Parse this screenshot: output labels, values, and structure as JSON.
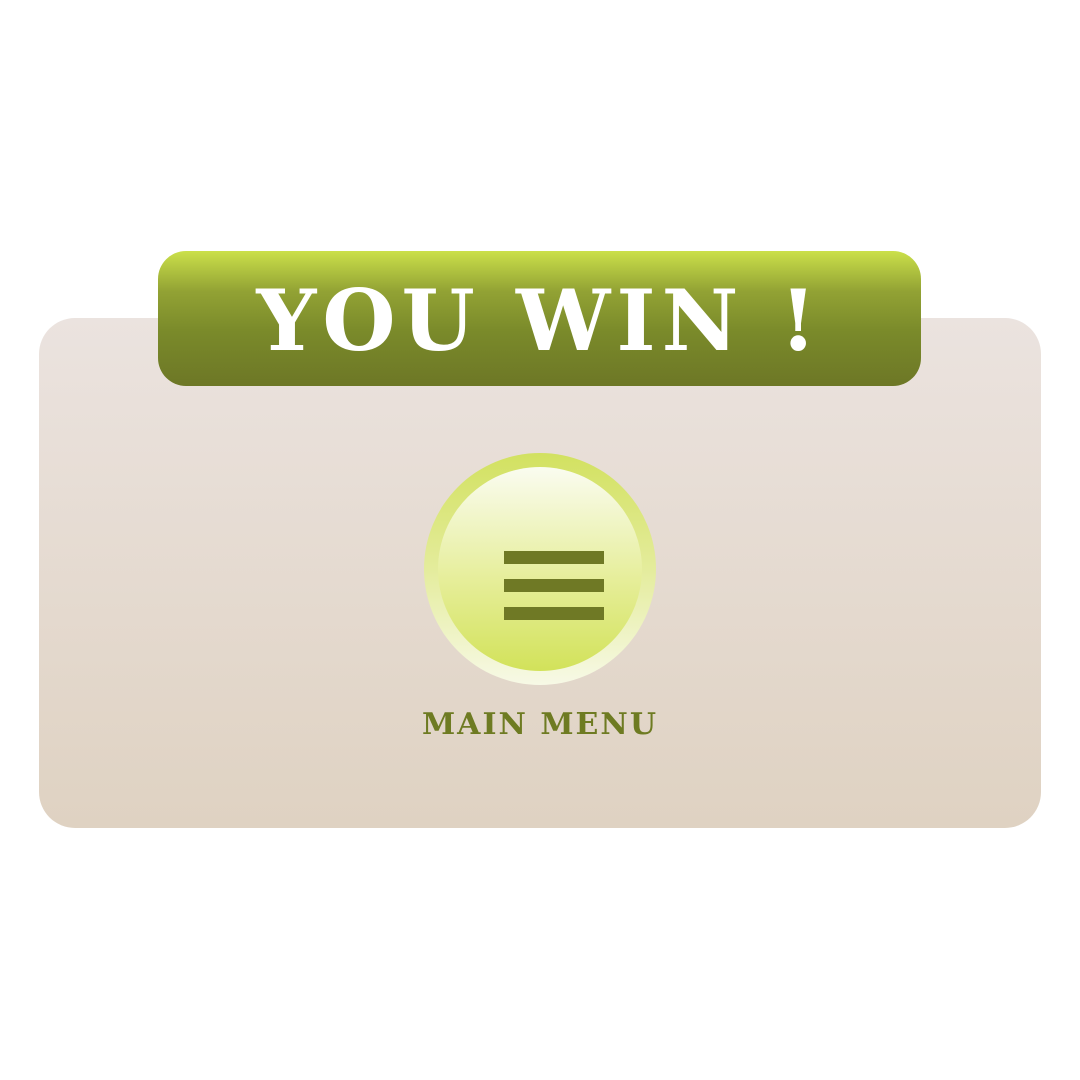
{
  "result_banner": {
    "title": "YOU WIN !"
  },
  "main_menu": {
    "label": "MAIN MENU",
    "icon": "hamburger-menu-icon"
  },
  "colors": {
    "banner_top": "#cbe04a",
    "banner_bottom": "#6d7726",
    "panel_top": "#ebe3df",
    "panel_bottom": "#dfd2c2",
    "accent_text": "#6e7b22",
    "button_light": "#f7f9e6",
    "button_lime": "#d2e25a"
  }
}
